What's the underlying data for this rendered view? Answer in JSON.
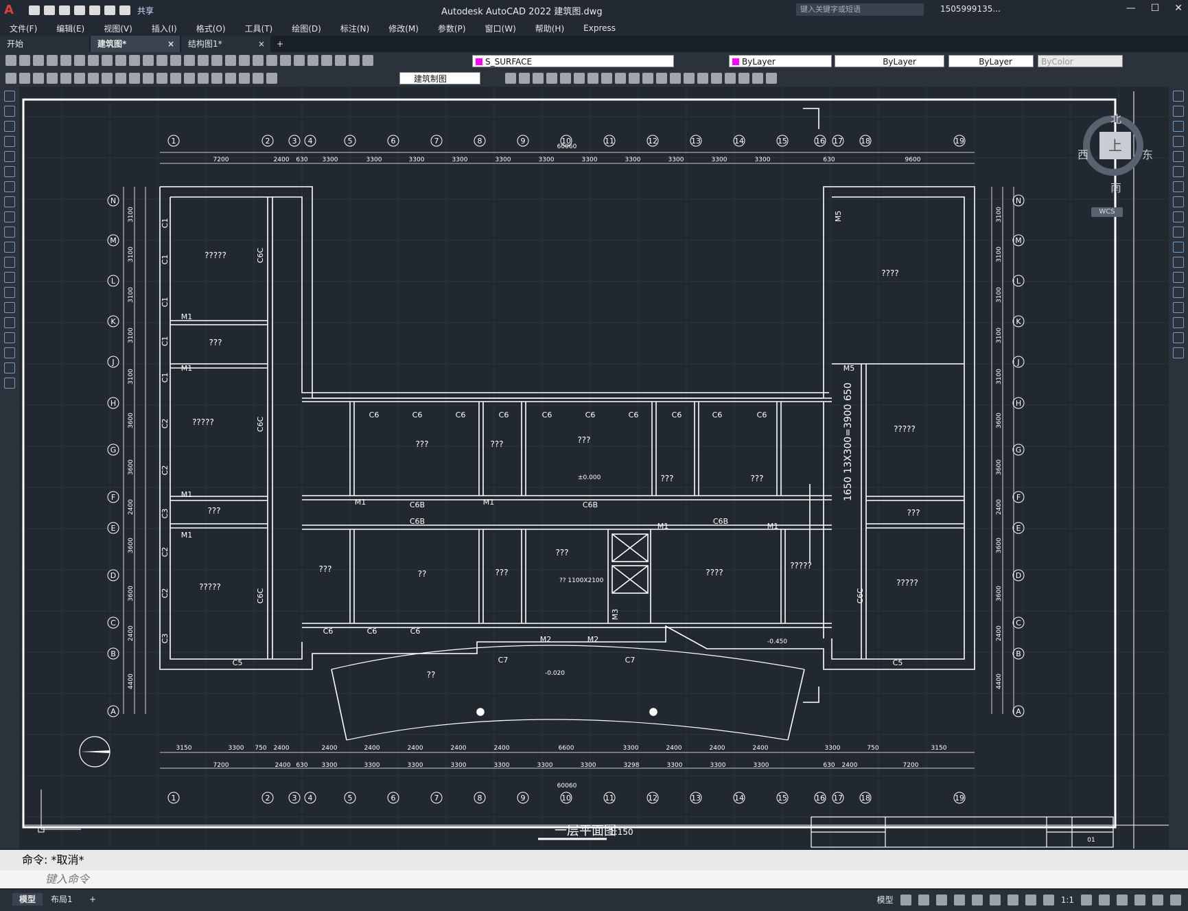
{
  "app": {
    "logo": "A",
    "title": "Autodesk AutoCAD 2022  建筑图.dwg",
    "share": "共享",
    "search_placeholder": "键入关键字或短语",
    "user": "1505999135...",
    "win_min": "—",
    "win_max": "☐",
    "win_close": "✕"
  },
  "menu": [
    "文件(F)",
    "编辑(E)",
    "视图(V)",
    "插入(I)",
    "格式(O)",
    "工具(T)",
    "绘图(D)",
    "标注(N)",
    "修改(M)",
    "参数(P)",
    "窗口(W)",
    "帮助(H)",
    "Express"
  ],
  "tabs": [
    {
      "label": "开始"
    },
    {
      "label": "建筑图*",
      "close": "×"
    },
    {
      "label": "结构图1*",
      "close": "×"
    }
  ],
  "tab_add": "+",
  "layer": {
    "name": "S_SURFACE",
    "color": "#ff00ff"
  },
  "props": {
    "color": "ByLayer",
    "linetype": "ByLayer",
    "lineweight": "ByLayer",
    "plotstyle": "ByColor"
  },
  "workspace": "建筑制图",
  "viewcube": {
    "north": "北",
    "south": "南",
    "east": "东",
    "west": "西",
    "top": "上",
    "wcs": "WCS"
  },
  "drawing": {
    "title": "一层平面图",
    "scale": "1:150",
    "total": "60060",
    "col_labels": [
      "1",
      "2",
      "3",
      "4",
      "5",
      "6",
      "7",
      "8",
      "9",
      "10",
      "11",
      "12",
      "13",
      "14",
      "15",
      "16",
      "17",
      "18",
      "19"
    ],
    "row_labels": [
      "N",
      "M",
      "L",
      "K",
      "J",
      "H",
      "G",
      "F",
      "E",
      "D",
      "C",
      "B",
      "A"
    ],
    "top_dims": [
      "7200",
      "2400",
      "630",
      "3300",
      "3300",
      "3300",
      "3300",
      "3300",
      "3300",
      "3300",
      "3300",
      "3300",
      "3300",
      "3300",
      "630",
      "9600"
    ],
    "bottom_dims": [
      "7200",
      "2400",
      "630",
      "3300",
      "3300",
      "3300",
      "3300",
      "3300",
      "3300",
      "3300",
      "3298",
      "3300",
      "3300",
      "3300",
      "630",
      "2400",
      "7200"
    ],
    "bottom_dims2": [
      "3150",
      "3300",
      "750",
      "2400",
      "2400",
      "2400",
      "2400",
      "2400",
      "2400",
      "6600",
      "3300",
      "2400",
      "2400",
      "2400",
      "3300",
      "750",
      "3150"
    ],
    "left_dims": [
      "3100",
      "3100",
      "3100",
      "3100",
      "3100",
      "3600",
      "3600",
      "2400",
      "3600",
      "3600",
      "2400",
      "4400"
    ],
    "rooms": [
      "?????",
      "???",
      "?????",
      "???",
      "?????",
      "???",
      "???",
      "???",
      "???",
      "???",
      "???",
      "??",
      "???",
      "???",
      "????",
      "?????",
      "???",
      "?????"
    ],
    "windows": [
      "C1",
      "C1",
      "C1",
      "C1",
      "C1",
      "C2",
      "C2",
      "C3",
      "C2",
      "C2",
      "C3",
      "C5",
      "C5",
      "C6",
      "C6",
      "C6",
      "C6",
      "C6",
      "C6",
      "C6",
      "C6",
      "C6",
      "C6",
      "C6",
      "C6",
      "C6",
      "C6B",
      "C6B",
      "C6B",
      "C6B",
      "C6C",
      "C6C",
      "C6C",
      "C6C",
      "C7",
      "C7"
    ],
    "doors": [
      "M1",
      "M1",
      "M1",
      "M1",
      "M1",
      "M1",
      "M1",
      "M1",
      "M2",
      "M2",
      "M3",
      "M5",
      "M5"
    ],
    "elevations": [
      "±0.000",
      "-0.450",
      "-0.020"
    ],
    "stair": "1650 13X300=3900 650",
    "lift": "?? 1100X2100",
    "title_block": "01"
  },
  "command": {
    "history": "命令: *取消*",
    "placeholder": "键入命令"
  },
  "status": {
    "model": "模型",
    "layout": "布局1",
    "add": "+",
    "space": "模型",
    "scale": "1:1"
  }
}
